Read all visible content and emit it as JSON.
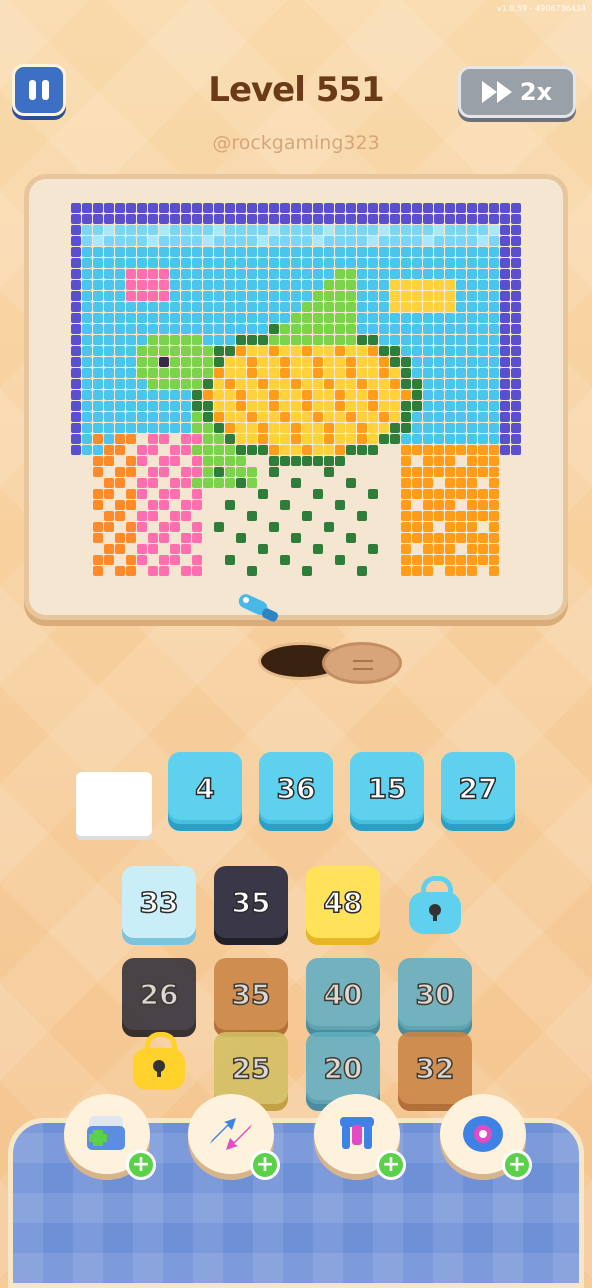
{
  "app": {
    "version": "v1.0.59 - 4908736434"
  },
  "header": {
    "level_title": "Level 551",
    "username": "@rockgaming323",
    "speed_label": "2x"
  },
  "queue": {
    "tiles": [
      "4",
      "36",
      "15",
      "27"
    ]
  },
  "grid": {
    "row1": [
      "33",
      "35",
      "48"
    ],
    "row2": [
      "26",
      "35",
      "40",
      "30"
    ],
    "row3": [
      "25",
      "20",
      "32"
    ]
  },
  "powerups": [
    {
      "icon": "add-slot-icon",
      "plus": "+"
    },
    {
      "icon": "shuffle-icon",
      "plus": "+"
    },
    {
      "icon": "magnet-icon",
      "plus": "+"
    },
    {
      "icon": "tape-icon",
      "plus": "+"
    }
  ],
  "colors": {
    "board_frame": "#e7c59d",
    "tray": "#6e90d6",
    "blue_tile": "#5fd1ee"
  }
}
